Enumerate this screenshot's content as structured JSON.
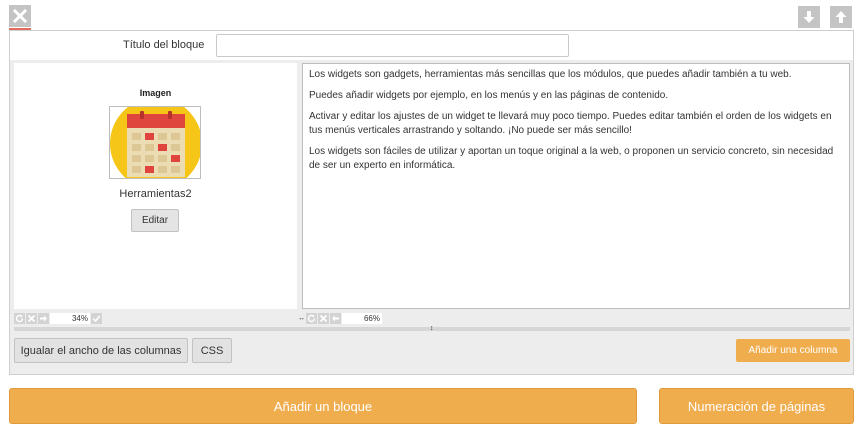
{
  "toolbar": {
    "close_icon": "close-icon",
    "move_down_icon": "arrow-down-icon",
    "move_up_icon": "arrow-up-icon"
  },
  "block": {
    "title_label": "Título del bloque",
    "title_value": "",
    "title_placeholder": ""
  },
  "left_column": {
    "widget_title": "Imagen",
    "widget_name": "Herramientas2",
    "edit_label": "Editar",
    "width_percent": "34%"
  },
  "right_column": {
    "paragraphs": [
      "Los widgets son gadgets, herramientas más sencillas que los módulos, que puedes añadir también a tu web.",
      "Puedes añadir widgets por ejemplo, en los menús y en las páginas de contenido.",
      "Activar y editar los ajustes de un widget te llevará muy poco tiempo. Puedes editar también el orden de los widgets en tus menús verticales arrastrando y soltando. ¡No puede ser más sencillo!",
      "Los widgets son fáciles de utilizar y aportan un toque original a la web, o proponen un servicio concreto, sin necesidad de ser un experto en informática."
    ],
    "width_percent": "66%"
  },
  "actions": {
    "equalize_label": "Igualar el ancho de las columnas",
    "css_label": "CSS",
    "add_column_label": "Añadir una columna"
  },
  "footer": {
    "add_block_label": "Añadir un bloque",
    "page_numbering_label": "Numeración de páginas"
  },
  "colors": {
    "accent_orange": "#f0ad4e",
    "icon_gray": "#c4c4c4",
    "close_underline": "#e06b5e",
    "panel_bg": "#ededed"
  }
}
